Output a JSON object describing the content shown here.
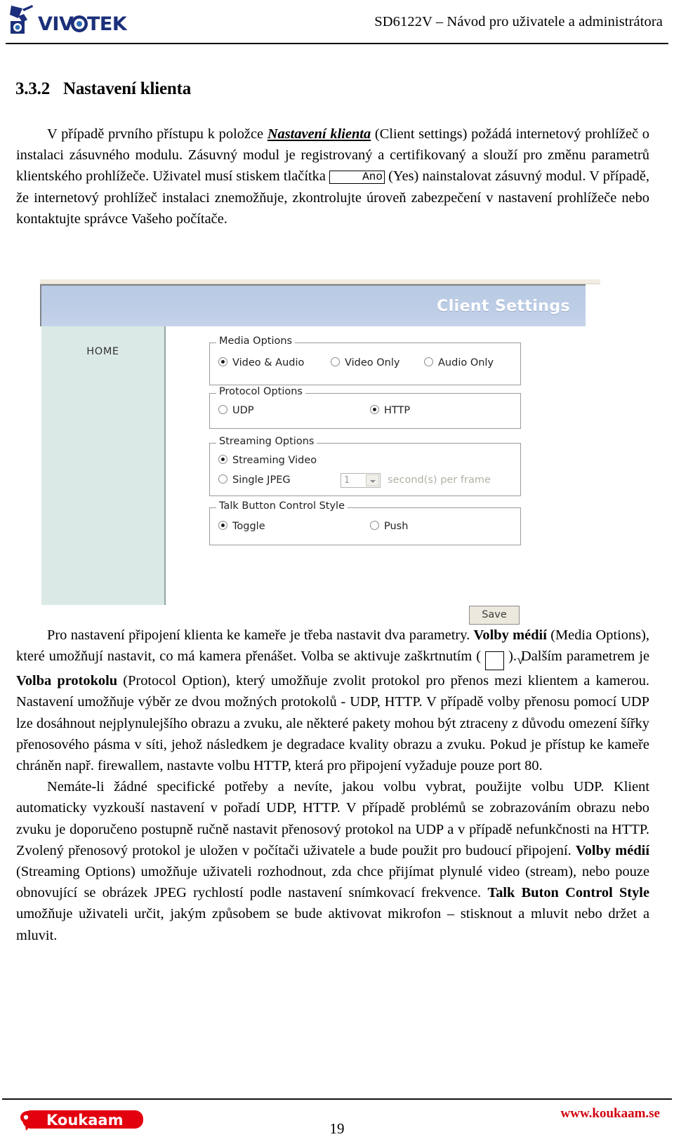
{
  "header": {
    "logo_alt": "VIVOTEK",
    "title": "SD6122V – Návod pro uživatele a administrátora"
  },
  "section": {
    "number": "3.3.2",
    "title": "Nastavení klienta"
  },
  "intro": {
    "p1_a": "V případě prvního přístupu k položce ",
    "p1_emph": "Nastavení klienta",
    "p1_b": " (Client settings) požádá internetový prohlížeč o instalaci zásuvného modulu. Zásuvný modul je registrovaný a certifikovaný a slouží pro změnu parametrů klientského prohlížeče. Uživatel musí stiskem tlačítka ",
    "p1_key": "Ano",
    "p1_c": " (Yes) nainstalovat zásuvný modul. V případě, že internetový prohlížeč instalaci znemožňuje, zkontrolujte úroveň zabezpečení v nastavení prohlížeče nebo kontaktujte správce Vašeho počítače."
  },
  "screenshot": {
    "window_title": "Client Settings",
    "sidebar": {
      "home_label": "HOME"
    },
    "groups": [
      {
        "legend": "Media Options",
        "options": [
          {
            "label": "Video & Audio",
            "selected": true
          },
          {
            "label": "Video Only",
            "selected": false
          },
          {
            "label": "Audio Only",
            "selected": false
          }
        ]
      },
      {
        "legend": "Protocol Options",
        "options": [
          {
            "label": "UDP",
            "selected": false
          },
          {
            "label": "HTTP",
            "selected": true
          }
        ]
      },
      {
        "legend": "Streaming Options",
        "options": [
          {
            "label": "Streaming Video",
            "selected": true
          },
          {
            "label": "Single JPEG",
            "selected": false
          }
        ],
        "interval_value": "1",
        "interval_hint": "second(s) per frame"
      },
      {
        "legend": "Talk Button Control Style",
        "options": [
          {
            "label": "Toggle",
            "selected": true
          },
          {
            "label": "Push",
            "selected": false
          }
        ]
      }
    ],
    "save_label": "Save",
    "colors": {
      "titlebar": "#bdcde6",
      "sidebar": "#dbe9e6",
      "save_button": "#ece8dd"
    }
  },
  "after": {
    "p2_a": "Pro nastavení připojení klienta ke kameře je třeba nastavit dva parametry. ",
    "p2_b1": "Volby médií",
    "p2_b": " (Media Options), které umožňují nastavit, co má kamera přenášet. Volba se aktivuje zaškrtnutím ( ",
    "p2_check": "√",
    "p2_c": " ). Dalším parametrem je ",
    "p2_b2": "Volba protokolu",
    "p2_d": " (Protocol Option), který umožňuje zvolit protokol pro přenos mezi klientem a kamerou. Nastavení umožňuje výběr ze dvou možných protokolů - UDP, HTTP. V případě volby přenosu pomocí UDP lze dosáhnout nejplynulejšího obrazu a zvuku, ale některé pakety mohou být ztraceny z důvodu omezení šířky přenosového pásma v síti, jehož následkem je degradace kvality obrazu a zvuku. Pokud je přístup ke kameře chráněn např. firewallem, nastavte volbu HTTP, která pro připojení vyžaduje pouze port 80.",
    "p3_a": "Nemáte-li žádné specifické potřeby a nevíte, jakou volbu vybrat, použijte volbu UDP. Klient automaticky vyzkouší nastavení v pořadí UDP, HTTP. V případě problémů se zobrazováním obrazu nebo zvuku je doporučeno postupně ručně nastavit přenosový protokol na UDP a v případě nefunkčnosti  na HTTP. Zvolený přenosový protokol je uložen v počítači uživatele a bude použit pro budoucí připojení. ",
    "p3_b1": "Volby médií",
    "p3_b": " (Streaming Options) umožňuje uživateli rozhodnout, zda chce přijímat plynulé video (stream), nebo pouze obnovující se obrázek JPEG rychlostí podle nastavení snímkovací frekvence. ",
    "p3_b2": "Talk Buton Control Style",
    "p3_c": " umožňuje uživateli určit, jakým způsobem se bude aktivovat mikrofon – stisknout a mluvit nebo držet a mluvit."
  },
  "footer": {
    "logo_alt": "Koukaam",
    "url": "www.koukaam.se",
    "page_number": "19"
  }
}
